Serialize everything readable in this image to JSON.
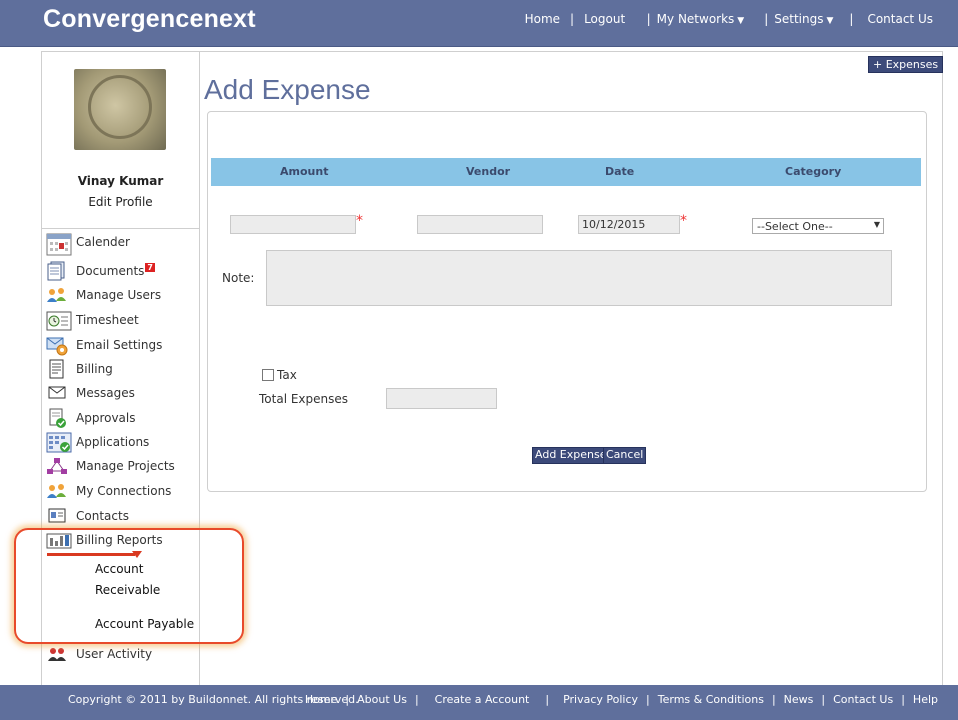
{
  "header": {
    "brand": "Convergencenext",
    "nav": [
      "Home",
      "Logout",
      "My Networks",
      "Settings",
      "Contact Us"
    ]
  },
  "sidebar": {
    "user_name": "Vinay Kumar",
    "edit_profile": "Edit Profile",
    "items": [
      {
        "label": "Calender",
        "icon": "calendar-icon"
      },
      {
        "label": "Documents",
        "icon": "documents-icon",
        "badge": "7"
      },
      {
        "label": "Manage Users",
        "icon": "users-icon"
      },
      {
        "label": "Timesheet",
        "icon": "timesheet-icon"
      },
      {
        "label": "Email Settings",
        "icon": "email-settings-icon"
      },
      {
        "label": "Billing",
        "icon": "billing-icon"
      },
      {
        "label": "Messages",
        "icon": "messages-icon"
      },
      {
        "label": "Approvals",
        "icon": "approvals-icon"
      },
      {
        "label": "Applications",
        "icon": "applications-icon"
      },
      {
        "label": "Manage Projects",
        "icon": "projects-icon"
      },
      {
        "label": "My Connections",
        "icon": "connections-icon"
      },
      {
        "label": "Contacts",
        "icon": "contacts-icon"
      },
      {
        "label": "Billing Reports",
        "icon": "reports-icon"
      }
    ],
    "sub_items": [
      "Account",
      "Receivable",
      "Account Payable"
    ],
    "user_activity": "User Activity"
  },
  "main": {
    "expenses_button": "+ Expenses",
    "title": "Add Expense",
    "columns": [
      "Amount",
      "Vendor",
      "Date",
      "Category"
    ],
    "date_value": "10/12/2015",
    "category_selected": "--Select One--",
    "note_label": "Note:",
    "tax_label": "Tax",
    "total_label": "Total Expenses",
    "add_button": "Add Expense",
    "cancel_button": "Cancel"
  },
  "footer": {
    "copyright": "Copyright © 2011 by Buildonnet. All rights reserved.",
    "links": [
      "Home",
      "About Us",
      "Create a Account",
      "Privacy Policy",
      "Terms & Conditions",
      "News",
      "Contact Us",
      "Help"
    ]
  },
  "colors": {
    "header_bg": "#5f6f9c",
    "table_header_bg": "#88c4e6",
    "button_bg": "#3c4a7a",
    "highlight": "#e84a2a"
  }
}
